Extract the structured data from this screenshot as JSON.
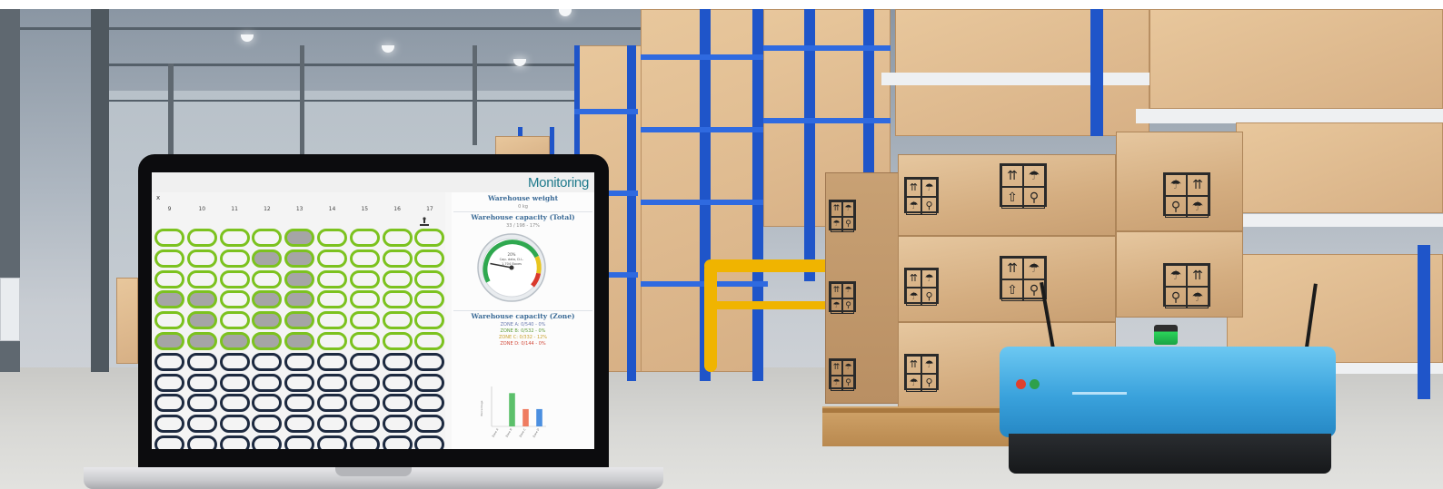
{
  "monitor": {
    "title": "Monitoring",
    "map": {
      "axis_label": "x",
      "columns": [
        "9",
        "10",
        "11",
        "12",
        "13",
        "14",
        "15",
        "16",
        "17"
      ],
      "rows": [
        [
          "g",
          "g",
          "g",
          "g",
          "o",
          "g",
          "g",
          "g",
          "g"
        ],
        [
          "g",
          "g",
          "g",
          "o",
          "o",
          "g",
          "g",
          "g",
          "g"
        ],
        [
          "g",
          "g",
          "g",
          "g",
          "o",
          "g",
          "g",
          "g",
          "g"
        ],
        [
          "o",
          "o",
          "g",
          "o",
          "o",
          "g",
          "g",
          "g",
          "g"
        ],
        [
          "g",
          "o",
          "g",
          "o",
          "o",
          "g",
          "g",
          "g",
          "g"
        ],
        [
          "o",
          "o",
          "o",
          "o",
          "o",
          "g",
          "g",
          "g",
          "g"
        ],
        [
          "n",
          "n",
          "n",
          "n",
          "n",
          "n",
          "n",
          "n",
          "n"
        ],
        [
          "n",
          "n",
          "n",
          "n",
          "n",
          "n",
          "n",
          "n",
          "n"
        ],
        [
          "n",
          "n",
          "n",
          "n",
          "n",
          "n",
          "n",
          "n",
          "n"
        ],
        [
          "n",
          "n",
          "n",
          "n",
          "n",
          "n",
          "n",
          "n",
          "n"
        ],
        [
          "n",
          "n",
          "n",
          "n",
          "n",
          "n",
          "n",
          "n",
          "n"
        ]
      ],
      "colors": {
        "green_border": "#7cc21f",
        "occupied_fill": "#a5a5a5",
        "free_fill": "#f4f4f4",
        "navy_border": "#1d2a40"
      }
    },
    "panel": {
      "weight_title": "Warehouse weight",
      "weight_value": "0 kg",
      "capacity_total_title": "Warehouse capacity (Total)",
      "capacity_total_value": "33 / 198 - 17%",
      "gauge": {
        "value_fraction": 0.17,
        "inner_line1": "20%",
        "inner_line2": "Cap. data, D.L.",
        "inner_line3": "1,704 Boxes"
      },
      "capacity_zone_title": "Warehouse capacity (Zone)",
      "zones": [
        {
          "label": "ZONE A: 0/540 - 0%",
          "color": "#6b7bb0"
        },
        {
          "label": "ZONE B: 0/532 - 0%",
          "color": "#5e9b3a"
        },
        {
          "label": "ZONE C: 0/332 - 12%",
          "color": "#c8a12c"
        },
        {
          "label": "ZONE D: 0/144 - 0%",
          "color": "#d24a3a"
        }
      ],
      "chart_data": {
        "type": "bar",
        "categories": [
          "Zone A",
          "Zone B",
          "Zone C",
          "Zone D"
        ],
        "values": [
          0,
          100,
          52,
          52
        ],
        "colors": [
          "#6b7bb0",
          "#5cc06b",
          "#ef7c61",
          "#4b8fe0"
        ],
        "ylim": [
          0,
          120
        ],
        "ylabel": "Percentage"
      }
    }
  },
  "scene": {
    "agv_colors": {
      "body": "#3aa2dc",
      "beacon": "#2bd45a"
    }
  }
}
